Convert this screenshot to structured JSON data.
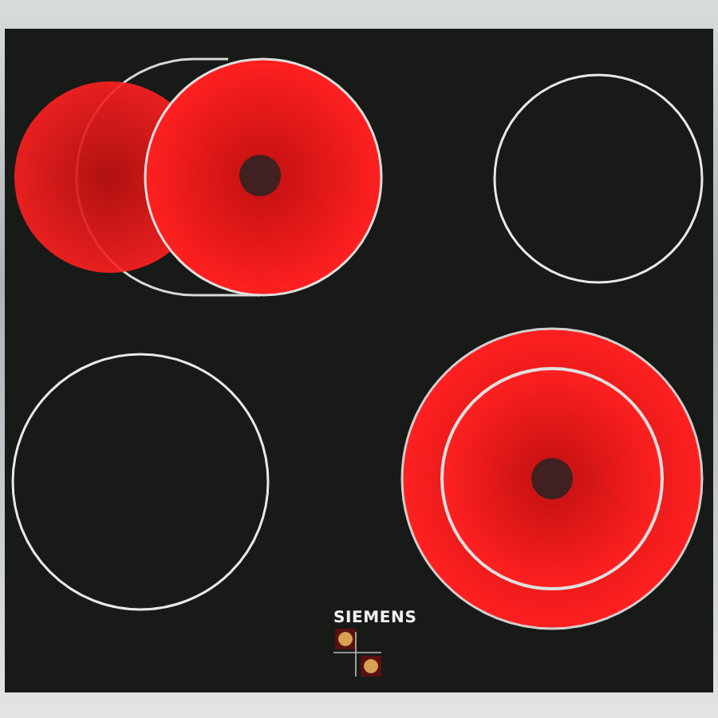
{
  "brand": "SIEMENS",
  "zones": [
    {
      "kind": "extended",
      "heated": true
    },
    {
      "kind": "single",
      "heated": false
    },
    {
      "kind": "single",
      "heated": false
    },
    {
      "kind": "dual",
      "heated": true
    }
  ]
}
